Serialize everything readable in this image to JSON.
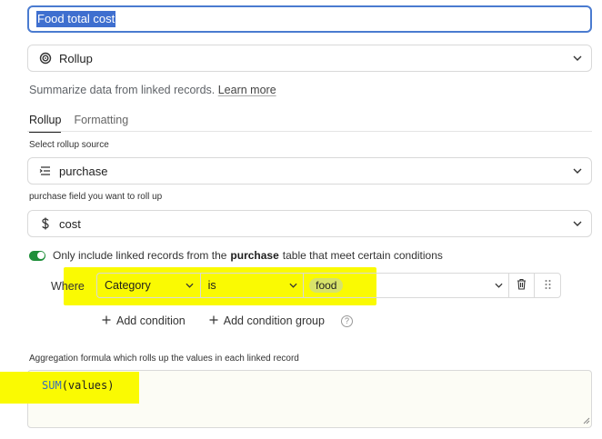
{
  "field_name": {
    "value": "Food total cost"
  },
  "field_type": {
    "label": "Rollup",
    "icon": "rollup-icon"
  },
  "description": {
    "text": "Summarize data from linked records.",
    "learn_more": "Learn more"
  },
  "tabs": [
    {
      "label": "Rollup",
      "active": true
    },
    {
      "label": "Formatting",
      "active": false
    }
  ],
  "rollup_source": {
    "label": "Select rollup source",
    "value": "purchase",
    "icon": "linked-table-icon"
  },
  "rollup_field": {
    "label": "purchase field you want to roll up",
    "value": "cost",
    "icon": "dollar-icon"
  },
  "conditions": {
    "toggle_on": true,
    "text_before": "Only include linked records from the",
    "table_name": "purchase",
    "text_after": "table that meet certain conditions",
    "where_label": "Where",
    "field": "Category",
    "operator": "is",
    "value": "food",
    "add_condition": "Add condition",
    "add_condition_group": "Add condition group"
  },
  "aggregation": {
    "label": "Aggregation formula which rolls up the values in each linked record",
    "fn": "SUM",
    "args": "(values)"
  },
  "colors": {
    "accent": "#3f6fcf",
    "toggle": "#1f8f3a",
    "highlight": "#fafa02",
    "pill": "#d8e36a"
  }
}
